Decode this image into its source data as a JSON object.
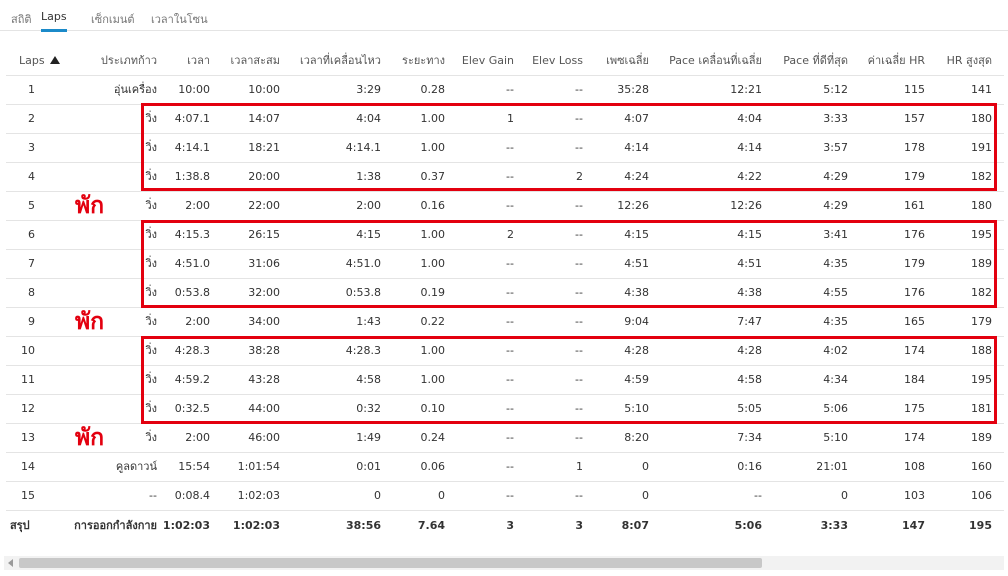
{
  "tabs": [
    {
      "label": "สถิติ"
    },
    {
      "label": "Laps"
    },
    {
      "label": "เซ็กเมนต์"
    },
    {
      "label": "เวลาในโซน"
    }
  ],
  "active_tab": "Laps",
  "sort": {
    "column": "Laps",
    "direction": "ascending",
    "icon": "sort-up-icon"
  },
  "table": {
    "columns": [
      "Laps",
      "ประเภทก้าว",
      "เวลา",
      "เวลาสะสม",
      "เวลาที่เคลื่อนไหว",
      "ระยะทาง",
      "Elev Gain",
      "Elev Loss",
      "เพซเฉลี่ย",
      "Pace เคลื่อนที่เฉลี่ย",
      "Pace ที่ดีที่สุด",
      "ค่าเฉลี่ย HR",
      "HR สูงสุด"
    ],
    "rows": [
      [
        "1",
        "อุ่นเครื่อง",
        "10:00",
        "10:00",
        "3:29",
        "0.28",
        "--",
        "--",
        "35:28",
        "12:21",
        "5:12",
        "115",
        "141"
      ],
      [
        "2",
        "วิ่ง",
        "4:07.1",
        "14:07",
        "4:04",
        "1.00",
        "1",
        "--",
        "4:07",
        "4:04",
        "3:33",
        "157",
        "180"
      ],
      [
        "3",
        "วิ่ง",
        "4:14.1",
        "18:21",
        "4:14.1",
        "1.00",
        "--",
        "--",
        "4:14",
        "4:14",
        "3:57",
        "178",
        "191"
      ],
      [
        "4",
        "วิ่ง",
        "1:38.8",
        "20:00",
        "1:38",
        "0.37",
        "--",
        "2",
        "4:24",
        "4:22",
        "4:29",
        "179",
        "182"
      ],
      [
        "5",
        "วิ่ง",
        "2:00",
        "22:00",
        "2:00",
        "0.16",
        "--",
        "--",
        "12:26",
        "12:26",
        "4:29",
        "161",
        "180"
      ],
      [
        "6",
        "วิ่ง",
        "4:15.3",
        "26:15",
        "4:15",
        "1.00",
        "2",
        "--",
        "4:15",
        "4:15",
        "3:41",
        "176",
        "195"
      ],
      [
        "7",
        "วิ่ง",
        "4:51.0",
        "31:06",
        "4:51.0",
        "1.00",
        "--",
        "--",
        "4:51",
        "4:51",
        "4:35",
        "179",
        "189"
      ],
      [
        "8",
        "วิ่ง",
        "0:53.8",
        "32:00",
        "0:53.8",
        "0.19",
        "--",
        "--",
        "4:38",
        "4:38",
        "4:55",
        "176",
        "182"
      ],
      [
        "9",
        "วิ่ง",
        "2:00",
        "34:00",
        "1:43",
        "0.22",
        "--",
        "--",
        "9:04",
        "7:47",
        "4:35",
        "165",
        "179"
      ],
      [
        "10",
        "วิ่ง",
        "4:28.3",
        "38:28",
        "4:28.3",
        "1.00",
        "--",
        "--",
        "4:28",
        "4:28",
        "4:02",
        "174",
        "188"
      ],
      [
        "11",
        "วิ่ง",
        "4:59.2",
        "43:28",
        "4:58",
        "1.00",
        "--",
        "--",
        "4:59",
        "4:58",
        "4:34",
        "184",
        "195"
      ],
      [
        "12",
        "วิ่ง",
        "0:32.5",
        "44:00",
        "0:32",
        "0.10",
        "--",
        "--",
        "5:10",
        "5:05",
        "5:06",
        "175",
        "181"
      ],
      [
        "13",
        "วิ่ง",
        "2:00",
        "46:00",
        "1:49",
        "0.24",
        "--",
        "--",
        "8:20",
        "7:34",
        "5:10",
        "174",
        "189"
      ],
      [
        "14",
        "คูลดาวน์",
        "15:54",
        "1:01:54",
        "0:01",
        "0.06",
        "--",
        "1",
        "0",
        "0:16",
        "21:01",
        "108",
        "160"
      ],
      [
        "15",
        "--",
        "0:08.4",
        "1:02:03",
        "0",
        "0",
        "--",
        "--",
        "0",
        "--",
        "0",
        "103",
        "106"
      ]
    ],
    "summary": [
      "สรุป",
      "การออกกำลังกาย",
      "1:02:03",
      "1:02:03",
      "38:56",
      "7.64",
      "3",
      "3",
      "8:07",
      "5:06",
      "3:33",
      "147",
      "195"
    ]
  },
  "annotations": {
    "rest_label": "พัก",
    "color": "#e3000f",
    "highlighted_lap_groups": [
      [
        "2",
        "3",
        "4"
      ],
      [
        "6",
        "7",
        "8"
      ],
      [
        "10",
        "11",
        "12"
      ]
    ],
    "rest_laps": [
      "5",
      "9",
      "13"
    ]
  },
  "colors": {
    "tab_active_underline": "#1b8ac9",
    "annotation_red": "#e3000f"
  }
}
